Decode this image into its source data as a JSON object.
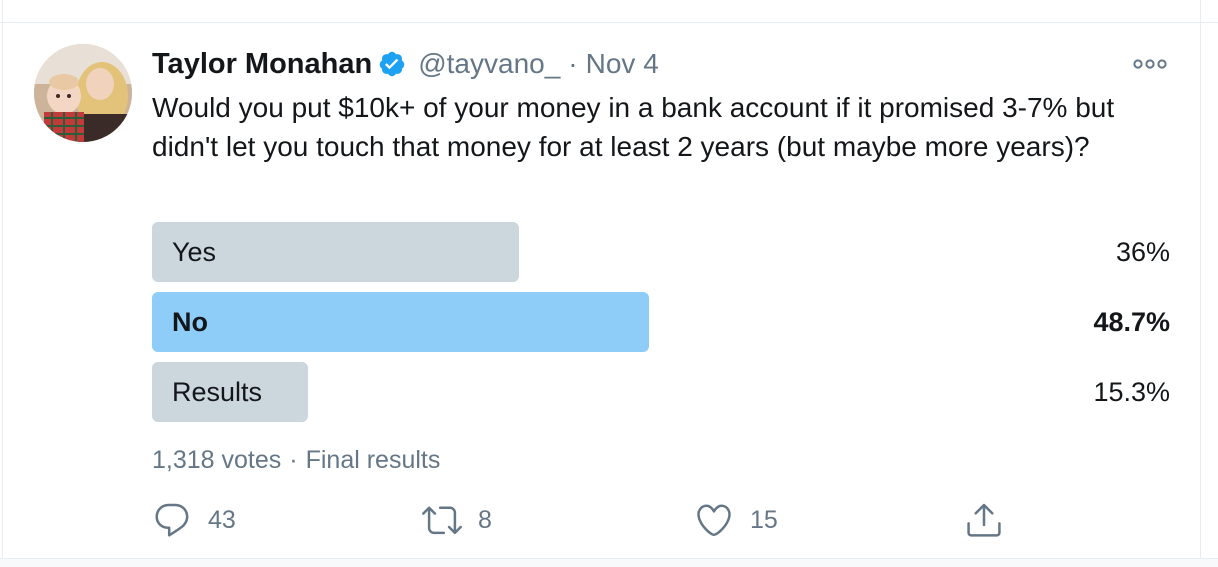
{
  "tweet": {
    "display_name": "Taylor Monahan",
    "handle": "@tayvano_",
    "separator": "·",
    "date": "Nov 4",
    "verified": true,
    "text": "Would you put $10k+ of your money in a bank account if it promised 3-7% but didn't let you touch that money for at least 2 years (but maybe more years)?"
  },
  "poll": {
    "options": [
      {
        "label": "Yes",
        "percent_text": "36%",
        "percent": 36,
        "winner": false
      },
      {
        "label": "No",
        "percent_text": "48.7%",
        "percent": 48.7,
        "winner": true
      },
      {
        "label": "Results",
        "percent_text": "15.3%",
        "percent": 15.3,
        "winner": false
      }
    ],
    "votes": "1,318 votes",
    "separator": "·",
    "status": "Final results"
  },
  "actions": {
    "reply_count": "43",
    "retweet_count": "8",
    "like_count": "15"
  },
  "colors": {
    "accent": "#1da1f2",
    "poll_winner": "#8ecdf8",
    "poll_other": "#ccd6dd",
    "muted_text": "#657786",
    "text": "#14171a"
  },
  "icons": {
    "verified": "verified-badge-icon",
    "more": "more-options-icon",
    "reply": "reply-icon",
    "retweet": "retweet-icon",
    "like": "heart-icon",
    "share": "share-icon"
  }
}
